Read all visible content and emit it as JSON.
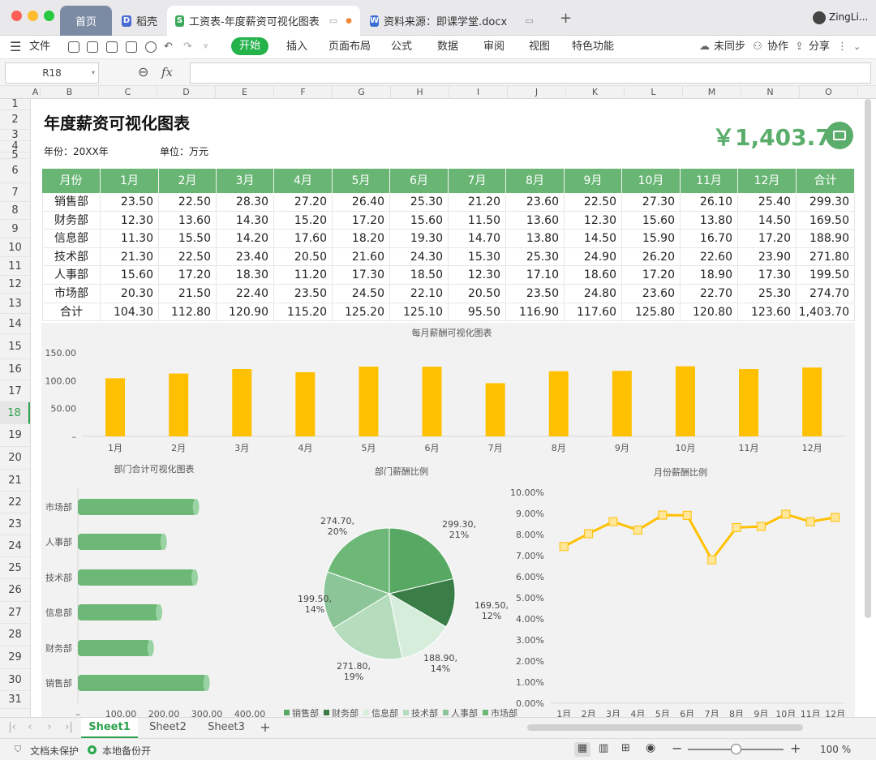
{
  "window": {
    "tabs": [
      {
        "label": "首页"
      },
      {
        "label": "稻壳"
      },
      {
        "label": "工资表-年度薪资可视化图表"
      },
      {
        "label": "资料来源：即课学堂.docx"
      }
    ],
    "user": "ZingLi..."
  },
  "toolbar": {
    "file": "文件",
    "menus": [
      "开始",
      "插入",
      "页面布局",
      "公式",
      "数据",
      "审阅",
      "视图",
      "特色功能"
    ],
    "sync": "未同步",
    "collab": "协作",
    "share": "分享"
  },
  "formula": {
    "namebox": "R18",
    "fx": "fx",
    "value": ""
  },
  "columns": [
    "A",
    "B",
    "C",
    "D",
    "E",
    "F",
    "G",
    "H",
    "I",
    "J",
    "K",
    "L",
    "M",
    "N",
    "O"
  ],
  "rows": [
    "1",
    "2",
    "3",
    "4",
    "5",
    "6",
    "7",
    "8",
    "9",
    "10",
    "11",
    "12",
    "13",
    "14",
    "15",
    "16",
    "17",
    "18",
    "19",
    "20",
    "21",
    "22",
    "23",
    "24",
    "25",
    "26",
    "27",
    "28",
    "29",
    "30",
    "31"
  ],
  "report": {
    "title": "年度薪资可视化图表",
    "year_label": "年份：20XX年",
    "unit_label": "单位：万元",
    "total_display": "￥1,403.70",
    "headers": [
      "月份",
      "1月",
      "2月",
      "3月",
      "4月",
      "5月",
      "6月",
      "7月",
      "8月",
      "9月",
      "10月",
      "11月",
      "12月",
      "合计"
    ],
    "rows": [
      [
        "销售部",
        "23.50",
        "22.50",
        "28.30",
        "27.20",
        "26.40",
        "25.30",
        "21.20",
        "23.60",
        "22.50",
        "27.30",
        "26.10",
        "25.40",
        "299.30"
      ],
      [
        "财务部",
        "12.30",
        "13.60",
        "14.30",
        "15.20",
        "17.20",
        "15.60",
        "11.50",
        "13.60",
        "12.30",
        "15.60",
        "13.80",
        "14.50",
        "169.50"
      ],
      [
        "信息部",
        "11.30",
        "15.50",
        "14.20",
        "17.60",
        "18.20",
        "19.30",
        "14.70",
        "13.80",
        "14.50",
        "15.90",
        "16.70",
        "17.20",
        "188.90"
      ],
      [
        "技术部",
        "21.30",
        "22.50",
        "23.40",
        "20.50",
        "21.60",
        "24.30",
        "15.30",
        "25.30",
        "24.90",
        "26.20",
        "22.60",
        "23.90",
        "271.80"
      ],
      [
        "人事部",
        "15.60",
        "17.20",
        "18.30",
        "11.20",
        "17.30",
        "18.50",
        "12.30",
        "17.10",
        "18.60",
        "17.20",
        "18.90",
        "17.30",
        "199.50"
      ],
      [
        "市场部",
        "20.30",
        "21.50",
        "22.40",
        "23.50",
        "24.50",
        "22.10",
        "20.50",
        "23.50",
        "24.80",
        "23.60",
        "22.70",
        "25.30",
        "274.70"
      ],
      [
        "合计",
        "104.30",
        "112.80",
        "120.90",
        "115.20",
        "125.20",
        "125.10",
        "95.50",
        "116.90",
        "117.60",
        "125.80",
        "120.80",
        "123.60",
        "1,403.70"
      ]
    ]
  },
  "chart_data": [
    {
      "type": "bar",
      "title": "每月薪酬可视化图表",
      "categories": [
        "1月",
        "2月",
        "3月",
        "4月",
        "5月",
        "6月",
        "7月",
        "8月",
        "9月",
        "10月",
        "11月",
        "12月"
      ],
      "values": [
        104.3,
        112.8,
        120.9,
        115.2,
        125.2,
        125.1,
        95.5,
        116.9,
        117.6,
        125.8,
        120.8,
        123.6
      ],
      "yticks": [
        "150.00",
        "100.00",
        "50.00",
        "–"
      ],
      "ylim": [
        0,
        150
      ],
      "color": "#ffc000"
    },
    {
      "type": "bar",
      "orientation": "horizontal",
      "title": "部门合计可视化图表",
      "categories": [
        "市场部",
        "人事部",
        "技术部",
        "信息部",
        "财务部",
        "销售部"
      ],
      "values": [
        274.7,
        199.5,
        271.8,
        188.9,
        169.5,
        299.3
      ],
      "xticks": [
        "–",
        "100.00",
        "200.00",
        "300.00",
        "400.00"
      ],
      "xlim": [
        0,
        400
      ],
      "color": "#6db877"
    },
    {
      "type": "pie",
      "title": "部门薪酬比例",
      "labels": [
        "销售部",
        "财务部",
        "信息部",
        "技术部",
        "人事部",
        "市场部"
      ],
      "values": [
        299.3,
        169.5,
        188.9,
        271.8,
        199.5,
        274.7
      ],
      "value_labels": [
        "299.30,",
        "169.50,",
        "188.90,",
        "271.80,",
        "199.50,",
        "274.70,"
      ],
      "percent_labels": [
        "21%",
        "12%",
        "14%",
        "19%",
        "14%",
        "20%"
      ],
      "colors": [
        "#57a862",
        "#3a7d47",
        "#d6eddb",
        "#b5dcbd",
        "#8cc598",
        "#6db877"
      ],
      "legend": [
        "销售部",
        "财务部",
        "信息部",
        "技术部",
        "人事部",
        "市场部"
      ]
    },
    {
      "type": "line",
      "title": "月份薪酬比例",
      "categories": [
        "1月",
        "2月",
        "3月",
        "4月",
        "5月",
        "6月",
        "7月",
        "8月",
        "9月",
        "10月",
        "11月",
        "12月"
      ],
      "values": [
        7.43,
        8.04,
        8.61,
        8.21,
        8.92,
        8.91,
        6.8,
        8.33,
        8.38,
        8.96,
        8.61,
        8.81
      ],
      "yticks": [
        "10.00%",
        "9.00%",
        "8.00%",
        "7.00%",
        "6.00%",
        "5.00%",
        "4.00%",
        "3.00%",
        "2.00%",
        "1.00%",
        "0.00%"
      ],
      "ylim": [
        0,
        10
      ],
      "color": "#ffc000"
    }
  ],
  "sheets": [
    "Sheet1",
    "Sheet2",
    "Sheet3"
  ],
  "status": {
    "protect": "文档未保护",
    "backup": "本地备份开",
    "zoom": "100 %"
  }
}
